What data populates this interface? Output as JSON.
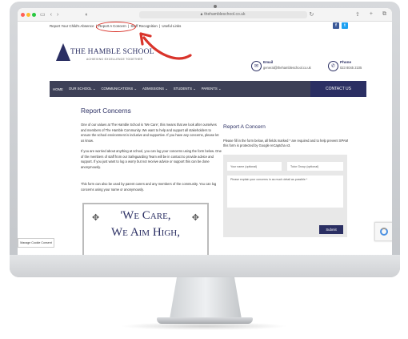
{
  "browser": {
    "url": "thehambleschool.co.uk",
    "nav_back": "‹",
    "nav_forward": "›",
    "reload_icon": "↻",
    "traffic_colors": [
      "#ff5f57",
      "#febc2e",
      "#28c840"
    ]
  },
  "topbar": {
    "link1": "Report Your Child's Absence",
    "sep1": "|",
    "link2": "Report A Concern",
    "sep2": "|",
    "link3": "Staff Recognition",
    "sep3": "|",
    "link4": "Useful Links",
    "facebook": "f",
    "twitter": "t"
  },
  "logo": {
    "title": "THE HAMBLE SCHOOL",
    "subtitle": "ACHIEVING EXCELLENCE TOGETHER"
  },
  "contact": {
    "email_label": "Email",
    "email_value": "general@thehambleschool.co.uk",
    "phone_label": "Phone",
    "phone_value": "023 8045 2105"
  },
  "nav": {
    "items": [
      "HOME",
      "OUR SCHOOL ⌄",
      "COMMUNICATIONS ⌄",
      "ADMISSIONS ⌄",
      "STUDENTS ⌄",
      "PARENTS ⌄"
    ],
    "contact": "CONTACT US"
  },
  "main": {
    "title": "Report Concerns",
    "p1": "One of our values at The Hamble School is 'We Care', this means that we look after ourselves and members of The Hamble Community. We want to help and support all stakeholders to ensure the school environment is inclusive and supportive. If you have any concerns, please let us know.",
    "p2": "If you are worried about anything at school, you can log your concerns using the form below. One of the members of staff from our Safeguarding Team will be in contact to provide advice and support. If you just want to log a worry but not receive advice or support this can be done anonymously.",
    "p3": "This form can also be used by parent carers and any members of the community. You can log concerns using your name or anonymously.",
    "motto_line1": "'We Care,",
    "motto_line2": "We Aim High,"
  },
  "form": {
    "title": "Report A Concern",
    "intro": "Please fill in the form below, all fields marked * are required and to help prevent SPAM this form is protected by Google reCaptcha v3.",
    "name_placeholder": "Your name (optional)",
    "tutor_placeholder": "Tutor Group (optional)",
    "message_placeholder": "Please explain your concerns in as much detail as possible *",
    "submit": "Submit"
  },
  "cookie": {
    "label": "Manage Cookie Consent"
  }
}
